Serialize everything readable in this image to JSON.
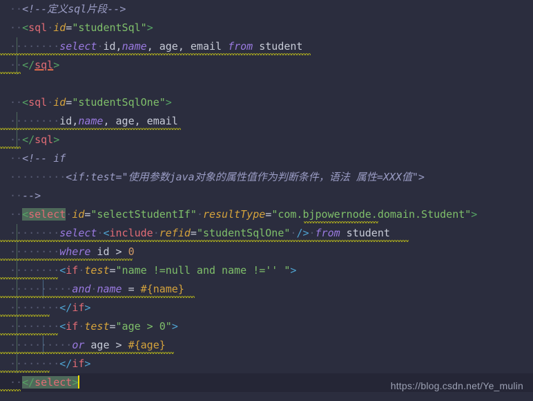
{
  "editor": {
    "background": "#2b2d3e",
    "current_line_background": "#252636",
    "caret_color": "#f4e000",
    "match_highlight_color": "#4e6a5a",
    "font_size_px": 15,
    "line_height_px": 27
  },
  "watermark": {
    "text": "https://blog.csdn.net/Ye_mulin"
  },
  "code": {
    "lines": [
      {
        "n": 1,
        "text": "  <!--定义sql片段-->",
        "comment": "定义sql片段"
      },
      {
        "n": 2,
        "text": "  <sql id=\"studentSql\">"
      },
      {
        "n": 3,
        "text": "        select id,name, age, email from student"
      },
      {
        "n": 4,
        "text": "  </sql>"
      },
      {
        "n": 5,
        "text": ""
      },
      {
        "n": 6,
        "text": "  <sql id=\"studentSqlOne\">"
      },
      {
        "n": 7,
        "text": "        id,name, age, email"
      },
      {
        "n": 8,
        "text": "  </sql>"
      },
      {
        "n": 9,
        "text": "  <!-- if"
      },
      {
        "n": 10,
        "text": "        <if:test=\"使用参数java对象的属性值作为判断条件，语法 属性=XXX值\">"
      },
      {
        "n": 11,
        "text": "  -->"
      },
      {
        "n": 12,
        "text": "  <select id=\"selectStudentIf\" resultType=\"com.bjpowernode.domain.Student\">"
      },
      {
        "n": 13,
        "text": "        select <include refid=\"studentSqlOne\" /> from student"
      },
      {
        "n": 14,
        "text": "        where id > 0"
      },
      {
        "n": 15,
        "text": "        <if test=\"name !=null and name !='' \">"
      },
      {
        "n": 16,
        "text": "            and name = #{name}"
      },
      {
        "n": 17,
        "text": "        </if>"
      },
      {
        "n": 18,
        "text": "        <if test=\"age > 0\">"
      },
      {
        "n": 19,
        "text": "            or age > #{age}"
      },
      {
        "n": 20,
        "text": "        </if>"
      },
      {
        "n": 21,
        "text": "  </select>"
      }
    ],
    "tokens": {
      "l1_comment": "<!--定义sql片段-->",
      "l2_open": "<",
      "l2_tag": "sql",
      "l2_attr": "id",
      "l2_eq": "=",
      "l2_val": "\"studentSql\"",
      "l2_close": ">",
      "l3_kw1": "select",
      "l3_id": "id,",
      "l3_name": "name",
      "l3_rest": ", age, email ",
      "l3_kw2": "from",
      "l3_tbl": " student",
      "l4_open": "</",
      "l4_tag": "sql",
      "l4_close": ">",
      "l6_val": "\"studentSqlOne\"",
      "l7_id": "id,",
      "l7_name": "name",
      "l7_rest": ", age, email",
      "l9_comment": "<!-- if",
      "l10_comment": "<if:test=\"使用参数java对象的属性值作为判断条件，语法 属性=XXX值\">",
      "l11_comment": "-->",
      "l12_open": "<",
      "l12_tag": "select",
      "l12_attr1": "id",
      "l12_val1": "\"selectStudentIf\"",
      "l12_attr2": "resultType",
      "l12_val2": "\"com.bjpowernode.domain.Student\"",
      "l12_close": ">",
      "l13_kw1": "select",
      "l13_open": "<",
      "l13_tag": "include",
      "l13_attr": "refid",
      "l13_val": "\"studentSqlOne\"",
      "l13_selfclose": "/>",
      "l13_kw2": "from",
      "l13_tbl": " student",
      "l14_kw": "where",
      "l14_expr": " id > ",
      "l14_num": "0",
      "l15_open": "<",
      "l15_tag": "if",
      "l15_attr": "test",
      "l15_val": "\"name !=null and name !='' \"",
      "l15_close": ">",
      "l16_kw": "and",
      "l16_name": "name",
      "l16_eq": " = ",
      "l16_param": "#{name}",
      "l17_open": "</",
      "l17_tag": "if",
      "l17_close": ">",
      "l18_val": "\"age > 0\"",
      "l19_kw": "or",
      "l19_expr": " age > ",
      "l19_param": "#{age}",
      "l21_open": "</",
      "l21_tag": "select",
      "l21_close": ">"
    }
  }
}
